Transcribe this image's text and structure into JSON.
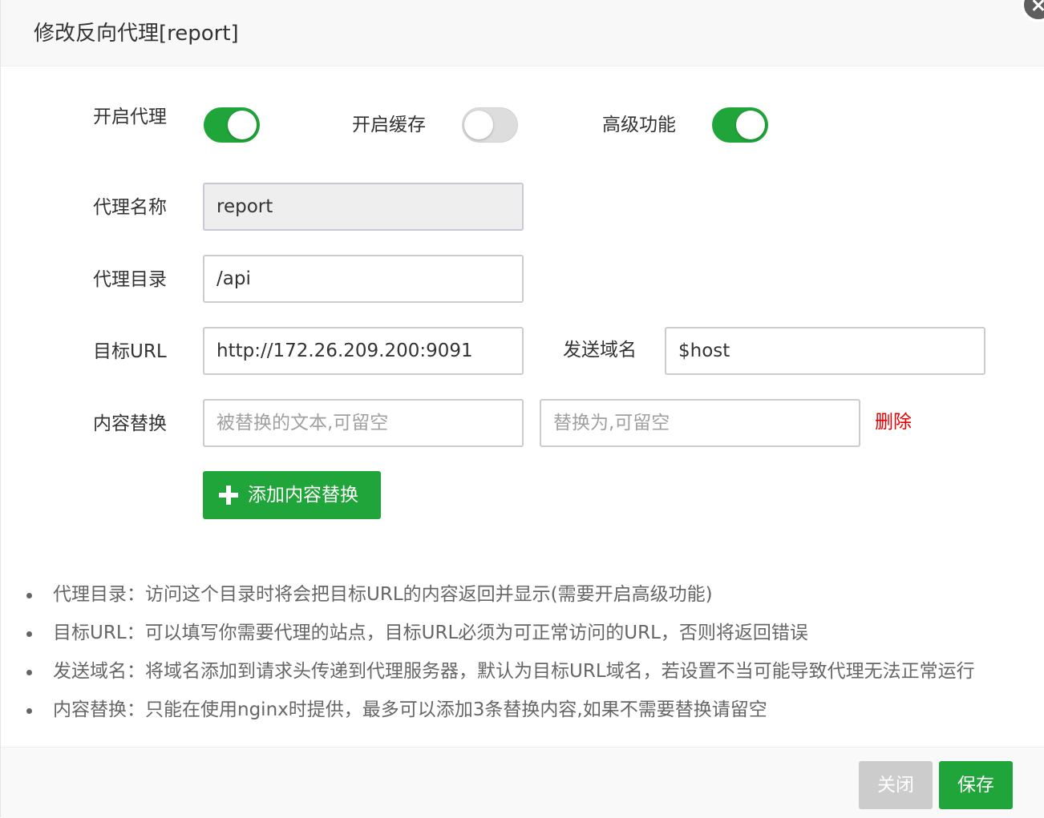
{
  "dialog": {
    "title": "修改反向代理[report]"
  },
  "toggles": {
    "proxy": {
      "label": "开启代理",
      "on": true
    },
    "cache": {
      "label": "开启缓存",
      "on": false
    },
    "advanced": {
      "label": "高级功能",
      "on": true
    }
  },
  "form": {
    "proxy_name": {
      "label": "代理名称",
      "value": "report"
    },
    "proxy_dir": {
      "label": "代理目录",
      "value": "/api"
    },
    "target_url": {
      "label": "目标URL",
      "value": "http://172.26.209.200:9091"
    },
    "send_domain": {
      "label": "发送域名",
      "value": "$host"
    },
    "content_replace": {
      "label": "内容替换",
      "from_placeholder": "被替换的文本,可留空",
      "to_placeholder": "替换为,可留空",
      "delete_label": "删除"
    },
    "add_replace_label": "添加内容替换"
  },
  "help": [
    "代理目录：访问这个目录时将会把目标URL的内容返回并显示(需要开启高级功能)",
    "目标URL：可以填写你需要代理的站点，目标URL必须为可正常访问的URL，否则将返回错误",
    "发送域名：将域名添加到请求头传递到代理服务器，默认为目标URL域名，若设置不当可能导致代理无法正常运行",
    "内容替换：只能在使用nginx时提供，最多可以添加3条替换内容,如果不需要替换请留空"
  ],
  "footer": {
    "close_label": "关闭",
    "save_label": "保存"
  },
  "colors": {
    "accent": "#20a53a",
    "danger": "#e60000",
    "disabled_button": "#cccccc"
  }
}
